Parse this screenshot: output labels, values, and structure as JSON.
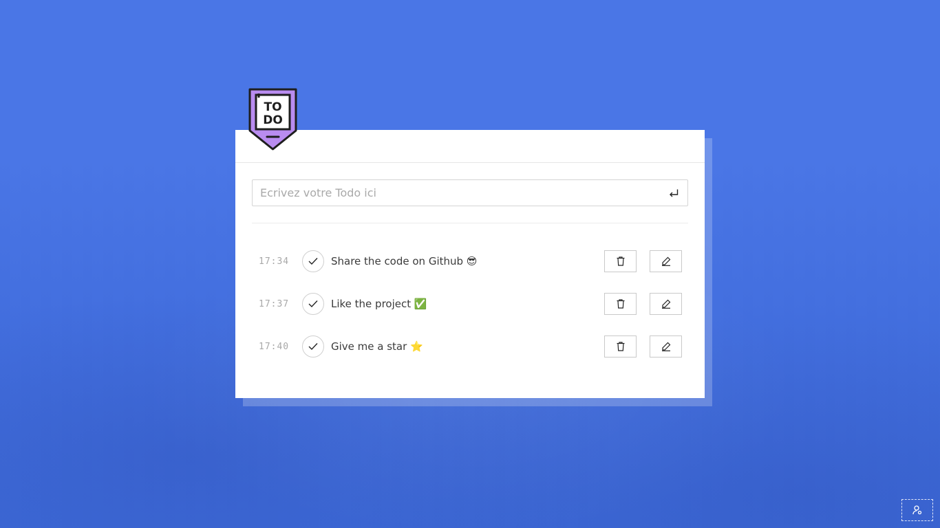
{
  "app": {
    "logo_text_line1": "TO",
    "logo_text_line2": "DO",
    "accent_color": "#4a76e6",
    "logo_color": "#b98cf0"
  },
  "input": {
    "placeholder": "Ecrivez votre Todo ici",
    "value": "",
    "submit_icon": "enter-icon"
  },
  "todos": [
    {
      "time": "17:34",
      "text": "Share the code on Github 😎"
    },
    {
      "time": "17:37",
      "text": "Like the project ✅"
    },
    {
      "time": "17:40",
      "text": "Give me a star ⭐"
    }
  ],
  "icons": {
    "check": "check-icon",
    "delete": "trash-icon",
    "edit": "pencil-icon",
    "corner": "user-settings-icon"
  }
}
